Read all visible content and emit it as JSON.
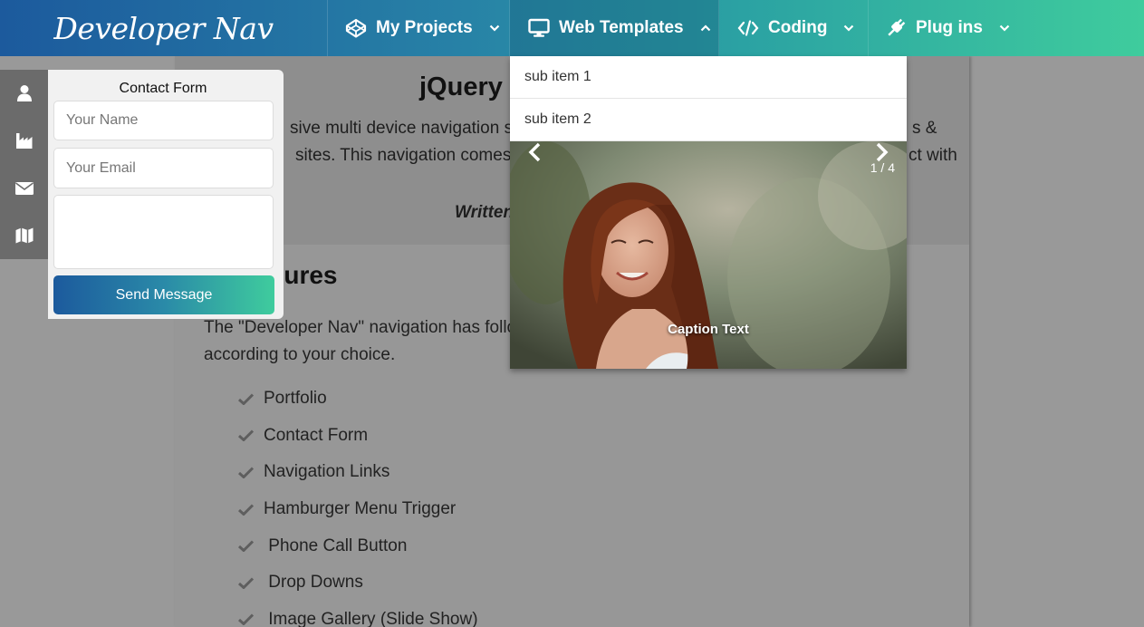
{
  "brand": {
    "name": "Developer Nav"
  },
  "nav": {
    "items": [
      {
        "label": "My Projects",
        "icon": "codepen-icon"
      },
      {
        "label": "Web Templates",
        "icon": "desktop-icon",
        "expanded": true
      },
      {
        "label": "Coding",
        "icon": "code-icon"
      },
      {
        "label": "Plug ins",
        "icon": "plug-icon"
      }
    ]
  },
  "dropdown": {
    "sub_items": [
      "sub item 1",
      "sub item 2"
    ],
    "gallery": {
      "counter": "1 / 4",
      "caption": "Caption Text"
    }
  },
  "sidebar": {
    "icons": [
      "user-icon",
      "industry-icon",
      "envelope-icon",
      "map-icon"
    ]
  },
  "contact_form": {
    "title": "Contact Form",
    "name_placeholder": "Your Name",
    "email_placeholder": "Your Email",
    "message_placeholder": "",
    "send_label": "Send Message"
  },
  "article": {
    "title": "jQuery D",
    "line1_left": "sive multi device navigation syst",
    "line1_right": "s &",
    "line2_left": "sites. This navigation comes wit",
    "line2_right": "ct with",
    "written": "Written",
    "features_heading": "UI Features",
    "intro_line1": "The \"Developer Nav\" navigation has followi",
    "intro_line2": "according to your choice.",
    "features": [
      "Portfolio",
      "Contact Form",
      "Navigation Links",
      "Hamburger Menu Trigger",
      " Phone Call Button",
      " Drop Downs",
      " Image Gallery (Slide Show)"
    ]
  },
  "colors": {
    "nav_gradient_start": "#1c5a9d",
    "nav_gradient_end": "#3fcc9d",
    "overlay_gray": "#999999",
    "sidebar_gray": "#6b6b6b"
  }
}
